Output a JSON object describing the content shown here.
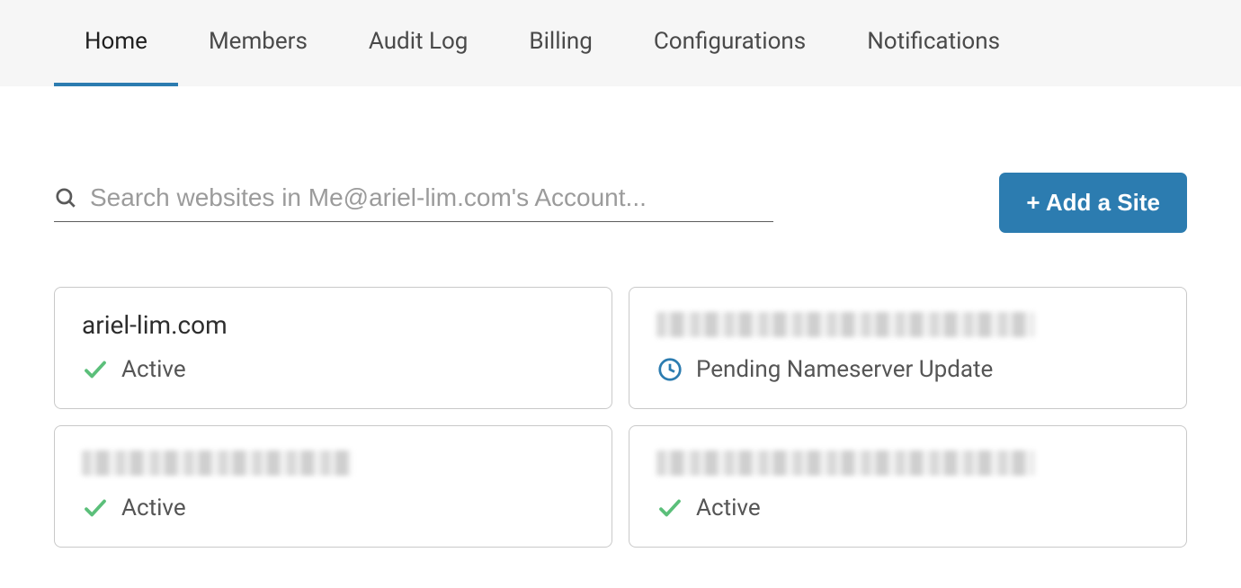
{
  "nav": {
    "items": [
      {
        "label": "Home",
        "active": true
      },
      {
        "label": "Members",
        "active": false
      },
      {
        "label": "Audit Log",
        "active": false
      },
      {
        "label": "Billing",
        "active": false
      },
      {
        "label": "Configurations",
        "active": false
      },
      {
        "label": "Notifications",
        "active": false
      }
    ]
  },
  "search": {
    "placeholder": "Search websites in Me@ariel-lim.com's Account..."
  },
  "actions": {
    "add_site_label": "+ Add a Site"
  },
  "status_labels": {
    "active": "Active",
    "pending": "Pending Nameserver Update"
  },
  "sites": [
    {
      "name": "ariel-lim.com",
      "status": "active",
      "redacted": false
    },
    {
      "name": "",
      "status": "pending",
      "redacted": true
    },
    {
      "name": "",
      "status": "active",
      "redacted": true
    },
    {
      "name": "",
      "status": "active",
      "redacted": true
    }
  ]
}
